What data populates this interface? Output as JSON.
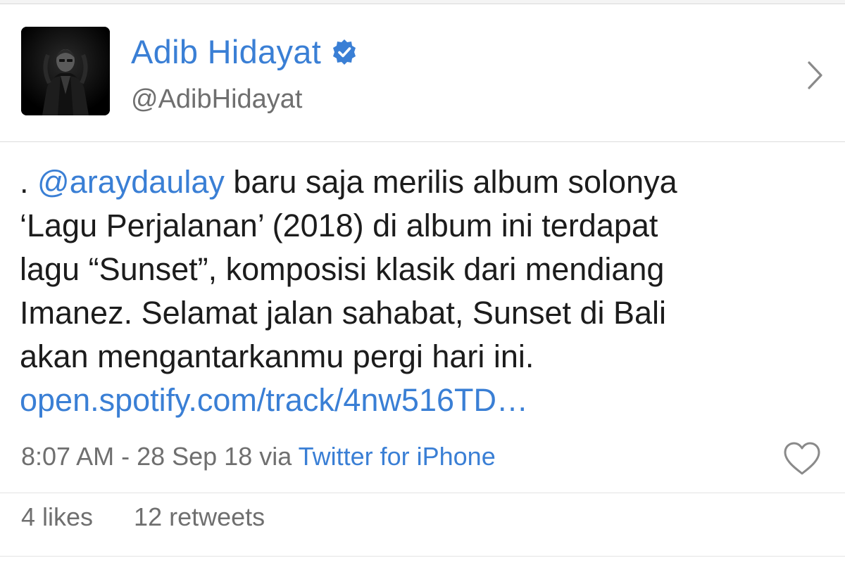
{
  "profile": {
    "display_name": "Adib Hidayat",
    "handle": "@AdibHidayat",
    "verified": true
  },
  "tweet": {
    "prefix": ". ",
    "mention": "@araydaulay",
    "line1_rest": " baru saja merilis album solonya",
    "line2": "‘Lagu Perjalanan’ (2018) di album ini terdapat",
    "line3": "lagu “Sunset”, komposisi klasik dari mendiang",
    "line4": "Imanez. Selamat jalan sahabat, Sunset di Bali",
    "line5": "akan mengantarkanmu pergi hari ini.",
    "link": "open.spotify.com/track/4nw516TD…"
  },
  "meta": {
    "timestamp": "8:07 AM - 28 Sep 18",
    "via": " via ",
    "source": "Twitter for iPhone"
  },
  "stats": {
    "likes": "4 likes",
    "retweets": "12 retweets"
  },
  "icons": {
    "verified": "verified-badge-icon",
    "chevron": "chevron-right-icon",
    "like": "heart-icon"
  },
  "colors": {
    "link": "#3a7fd5",
    "secondary_text": "#6f6f6f",
    "primary_text": "#1c1c1c"
  }
}
